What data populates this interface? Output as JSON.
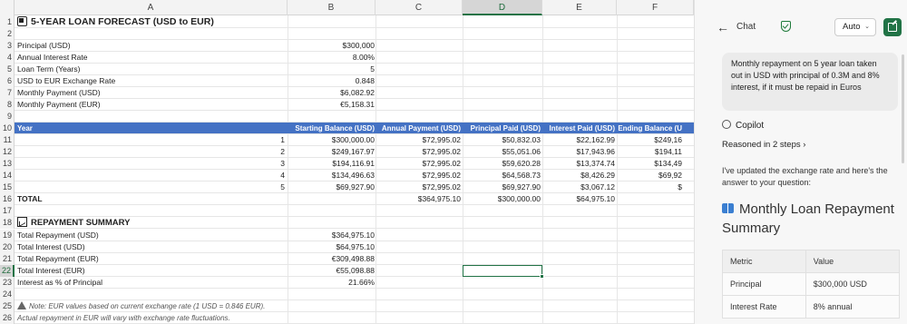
{
  "sheet": {
    "columns": [
      "A",
      "B",
      "C",
      "D",
      "E",
      "F"
    ],
    "selected_column": "D",
    "selected_row": "22",
    "rows": {
      "r1": {
        "a": "5-YEAR LOAN FORECAST (USD to EUR)"
      },
      "r3": {
        "a": "Principal (USD)",
        "b": "$300,000"
      },
      "r4": {
        "a": "Annual Interest Rate",
        "b": "8.00%"
      },
      "r5": {
        "a": "Loan Term (Years)",
        "b": "5"
      },
      "r6": {
        "a": "USD to EUR Exchange Rate",
        "b": "0.848"
      },
      "r7": {
        "a": "Monthly Payment (USD)",
        "b": "$6,082.92"
      },
      "r8": {
        "a": "Monthly Payment (EUR)",
        "b": "€5,158.31"
      },
      "r10": {
        "a": "Year",
        "b": "Starting Balance (USD)",
        "c": "Annual Payment (USD)",
        "d": "Principal Paid (USD)",
        "e": "Interest Paid (USD)",
        "f": "Ending Balance (U"
      },
      "r11": {
        "year": "1",
        "b": "$300,000.00",
        "c": "$72,995.02",
        "d": "$50,832.03",
        "e": "$22,162.99",
        "f": "$249,16"
      },
      "r12": {
        "year": "2",
        "b": "$249,167.97",
        "c": "$72,995.02",
        "d": "$55,051.06",
        "e": "$17,943.96",
        "f": "$194,11"
      },
      "r13": {
        "year": "3",
        "b": "$194,116.91",
        "c": "$72,995.02",
        "d": "$59,620.28",
        "e": "$13,374.74",
        "f": "$134,49"
      },
      "r14": {
        "year": "4",
        "b": "$134,496.63",
        "c": "$72,995.02",
        "d": "$64,568.73",
        "e": "$8,426.29",
        "f": "$69,92"
      },
      "r15": {
        "year": "5",
        "b": "$69,927.90",
        "c": "$72,995.02",
        "d": "$69,927.90",
        "e": "$3,067.12",
        "f": "$"
      },
      "r16": {
        "a": "TOTAL",
        "c": "$364,975.10",
        "d": "$300,000.00",
        "e": "$64,975.10"
      },
      "r18": {
        "a": "REPAYMENT SUMMARY"
      },
      "r19": {
        "a": "Total Repayment (USD)",
        "b": "$364,975.10"
      },
      "r20": {
        "a": "Total Interest (USD)",
        "b": "$64,975.10"
      },
      "r21": {
        "a": "Total Repayment (EUR)",
        "b": "€309,498.88"
      },
      "r22": {
        "a": "Total Interest (EUR)",
        "b": "€55,098.88"
      },
      "r23": {
        "a": "Interest as % of Principal",
        "b": "21.66%"
      },
      "r25": {
        "a": "Note: EUR values based on current exchange rate (1 USD = 0.846 EUR)."
      },
      "r26": {
        "a": "Actual repayment in EUR will vary with exchange rate fluctuations."
      }
    }
  },
  "panel": {
    "title": "Chat",
    "mode": "Auto",
    "user_message": "Monthly repayment on 5 year loan taken out in USD with principal of 0.3M and 8% interest, if it must be repaid in Euros",
    "assistant_name": "Copilot",
    "reasoned": "Reasoned in 2 steps",
    "answer_intro": "I've updated the exchange rate and here's the answer to your question:",
    "summary_title": "Monthly Loan Repayment Summary",
    "table_headers": [
      "Metric",
      "Value"
    ],
    "table_rows": [
      {
        "metric": "Principal",
        "value": "$300,000 USD"
      },
      {
        "metric": "Interest Rate",
        "value": "8% annual"
      }
    ]
  },
  "colors": {
    "header_blue": "#4472c4",
    "excel_green": "#217346"
  }
}
